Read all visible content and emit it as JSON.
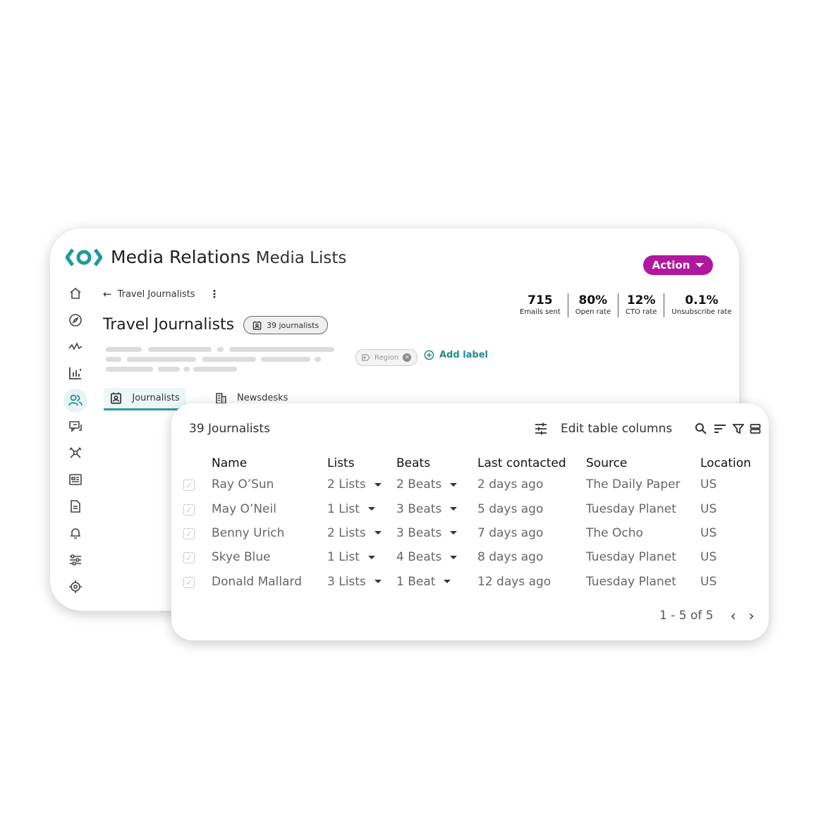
{
  "app": {
    "name": "Media Relations",
    "section": "Media Lists",
    "action_label": "Action"
  },
  "colors": {
    "brand_teal": "#1e9a9a",
    "action_magenta": "#b0179e",
    "tab_accent": "#2a9a9a"
  },
  "sidebar": {
    "items": [
      {
        "icon": "home-icon"
      },
      {
        "icon": "compass-icon"
      },
      {
        "icon": "activity-icon"
      },
      {
        "icon": "analytics-icon"
      },
      {
        "icon": "people-icon",
        "active": true
      },
      {
        "icon": "chat-icon"
      },
      {
        "icon": "network-icon"
      },
      {
        "icon": "newspaper-icon"
      },
      {
        "icon": "document-icon"
      },
      {
        "icon": "bell-icon"
      },
      {
        "icon": "sliders-icon"
      },
      {
        "icon": "settings-icon"
      }
    ]
  },
  "breadcrumb": {
    "label": "Travel Journalists"
  },
  "list": {
    "title": "Travel Journalists",
    "count_badge": "39 journalists"
  },
  "stats": [
    {
      "value": "715",
      "label": "Emails sent"
    },
    {
      "value": "80%",
      "label": "Open rate"
    },
    {
      "value": "12%",
      "label": "CTO rate"
    },
    {
      "value": "0.1%",
      "label": "Unsubscribe rate"
    }
  ],
  "labels": {
    "region_chip": "Region",
    "add_label": "Add label"
  },
  "tabs": [
    {
      "label": "Journalists",
      "icon": "contact-card-icon",
      "active": true
    },
    {
      "label": "Newsdesks",
      "icon": "building-icon",
      "active": false
    }
  ],
  "table": {
    "title": "39 Journalists",
    "edit_columns_label": "Edit table columns",
    "columns": [
      "Name",
      "Lists",
      "Beats",
      "Last contacted",
      "Source",
      "Location"
    ],
    "rows": [
      {
        "name": "Ray O’Sun",
        "lists": "2 Lists",
        "beats": "2 Beats",
        "last_contacted": "2 days ago",
        "source": "The Daily Paper",
        "location": "US"
      },
      {
        "name": "May O’Neil",
        "lists": "1 List",
        "beats": "3 Beats",
        "last_contacted": "5 days ago",
        "source": "Tuesday Planet",
        "location": "US"
      },
      {
        "name": "Benny Urich",
        "lists": "2 Lists",
        "beats": "3 Beats",
        "last_contacted": "7 days ago",
        "source": "The Ocho",
        "location": "US"
      },
      {
        "name": "Skye Blue",
        "lists": "1 List",
        "beats": "4 Beats",
        "last_contacted": "8 days ago",
        "source": "Tuesday Planet",
        "location": "US"
      },
      {
        "name": "Donald Mallard",
        "lists": "3 Lists",
        "beats": "1 Beat",
        "last_contacted": "12 days ago",
        "source": "Tuesday Planet",
        "location": "US"
      }
    ],
    "pagination": "1 - 5 of 5"
  }
}
